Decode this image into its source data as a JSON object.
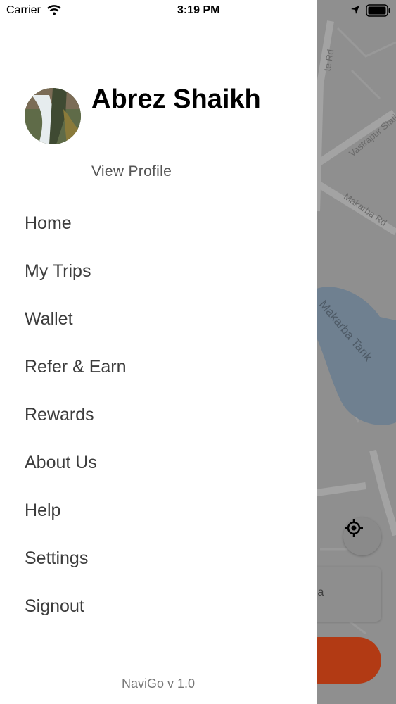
{
  "status_bar": {
    "carrier": "Carrier",
    "time": "3:19 PM",
    "icons": [
      "wifi-icon",
      "location-arrow-icon",
      "battery-icon"
    ]
  },
  "map": {
    "labels": [
      "te Rd",
      "Vastrapur Stati",
      "Makarba Rd",
      "Makarba Tank"
    ],
    "input_fragment": "ia",
    "icons": [
      "locate-icon"
    ]
  },
  "drawer": {
    "profile": {
      "name": "Abrez Shaikh",
      "view_profile": "View Profile"
    },
    "menu": [
      {
        "label": "Home"
      },
      {
        "label": "My Trips"
      },
      {
        "label": "Wallet"
      },
      {
        "label": "Refer & Earn"
      },
      {
        "label": "Rewards"
      },
      {
        "label": "About Us"
      },
      {
        "label": "Help"
      },
      {
        "label": "Settings"
      },
      {
        "label": "Signout"
      }
    ],
    "version": "NaviGo v 1.0"
  },
  "colors": {
    "accent": "#b23a14",
    "drawer_bg": "#ffffff",
    "overlay": "#8f8f8f",
    "water": "#6f8090"
  }
}
